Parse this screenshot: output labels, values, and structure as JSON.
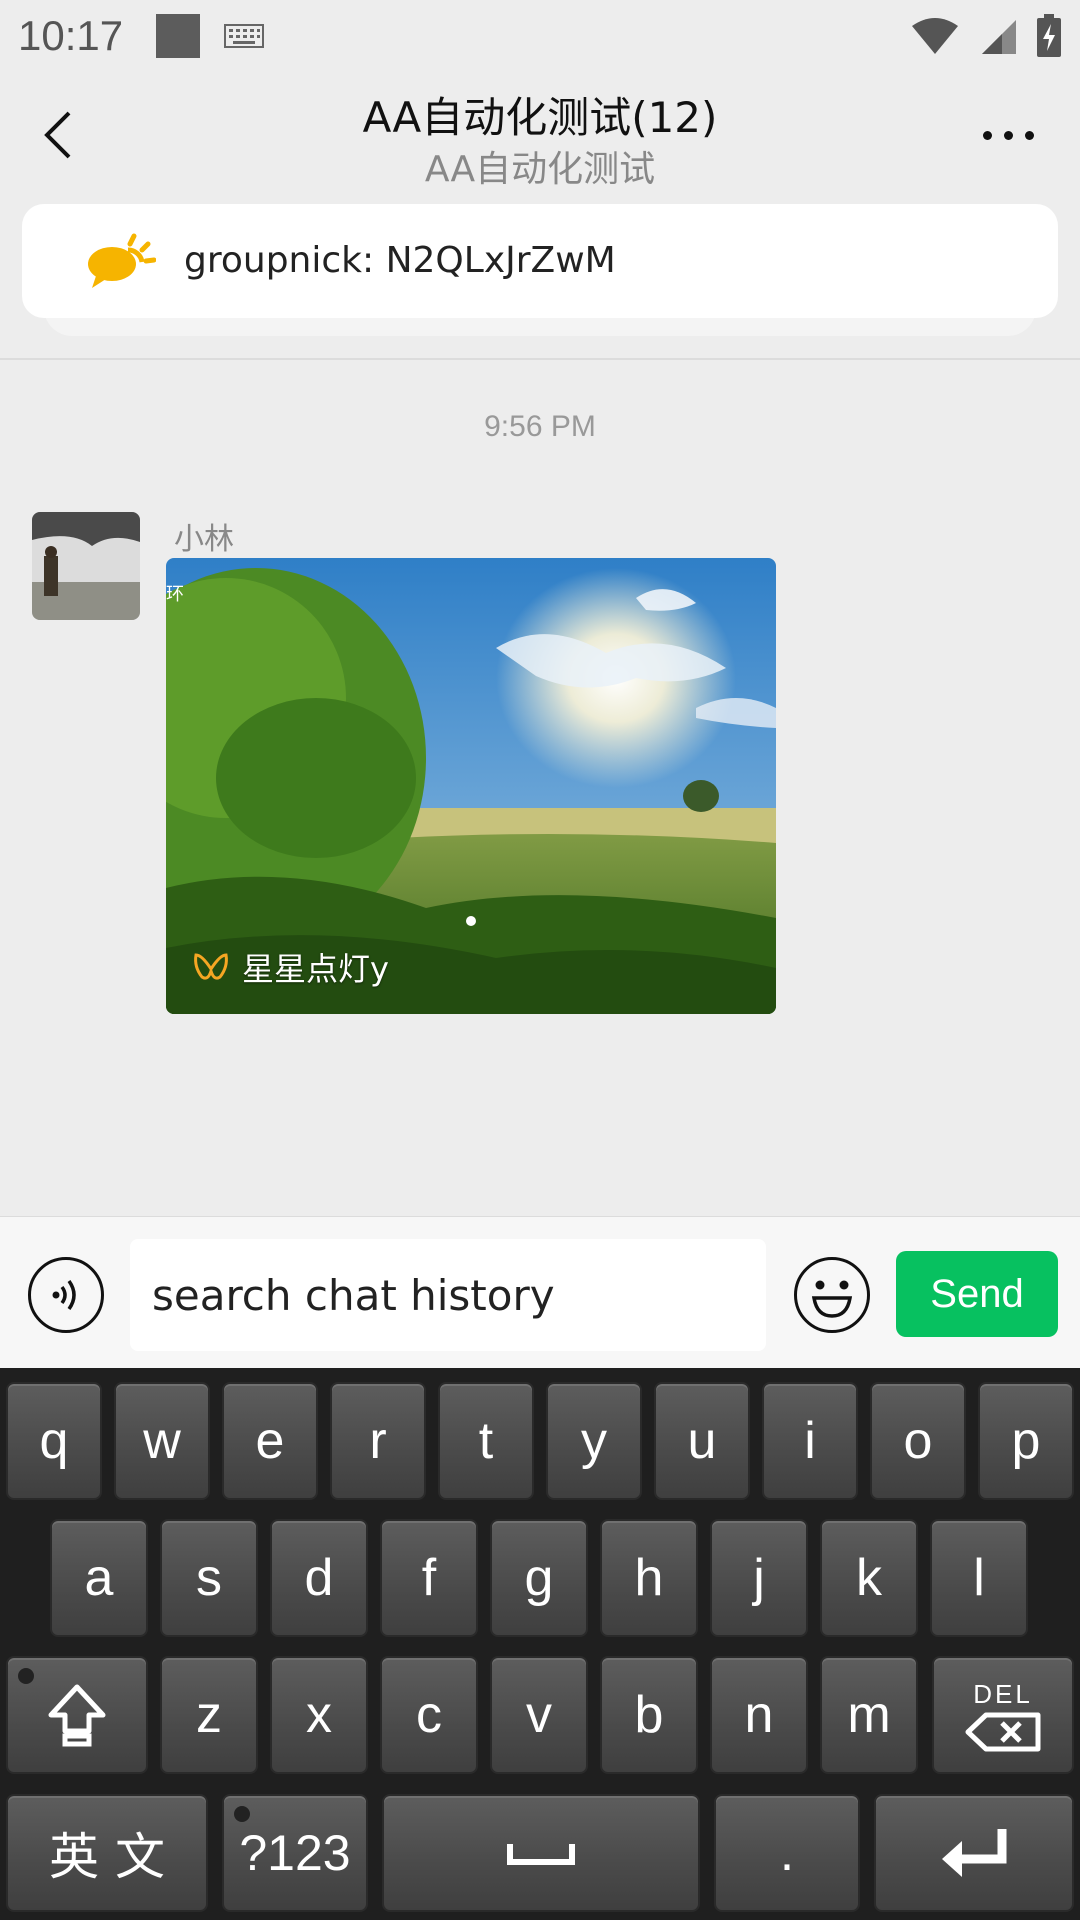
{
  "status_bar": {
    "time": "10:17",
    "icons": [
      "square-icon",
      "keyboard-icon",
      "wifi-icon",
      "signal-icon",
      "battery-icon"
    ]
  },
  "header": {
    "title": "AA自动化测试(12)",
    "subtitle": "AA自动化测试"
  },
  "notice": {
    "text": "groupnick: N2QLxJrZwM",
    "icon": "speech-bubble-sun-icon"
  },
  "chat": {
    "timestamp": "9:56 PM",
    "messages": [
      {
        "sender": "小林",
        "type": "video",
        "caption": "星星点灯y",
        "corner_label": "环"
      }
    ]
  },
  "input_bar": {
    "value": "search chat history",
    "send_label": "Send",
    "accent_color": "#07c160"
  },
  "keyboard": {
    "row1": [
      "q",
      "w",
      "e",
      "r",
      "t",
      "y",
      "u",
      "i",
      "o",
      "p"
    ],
    "row2": [
      "a",
      "s",
      "d",
      "f",
      "g",
      "h",
      "j",
      "k",
      "l"
    ],
    "row3": [
      "z",
      "x",
      "c",
      "v",
      "b",
      "n",
      "m"
    ],
    "lang_label": "英 文",
    "symbols_label": "?123",
    "period_label": ".",
    "del_label": "DEL"
  }
}
